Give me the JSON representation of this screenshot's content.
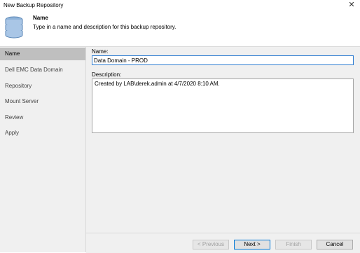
{
  "window": {
    "title": "New Backup Repository",
    "close_icon": "close-icon"
  },
  "header": {
    "icon": "database-icon",
    "title": "Name",
    "description": "Type in a name and description for this backup repository."
  },
  "sidebar": {
    "steps": [
      {
        "label": "Name",
        "active": true
      },
      {
        "label": "Dell EMC Data Domain",
        "active": false
      },
      {
        "label": "Repository",
        "active": false
      },
      {
        "label": "Mount Server",
        "active": false
      },
      {
        "label": "Review",
        "active": false
      },
      {
        "label": "Apply",
        "active": false
      }
    ]
  },
  "form": {
    "name_label": "Name:",
    "name_value": "Data Domain - PROD",
    "description_label": "Description:",
    "description_value": "Created by LAB\\derek.admin at 4/7/2020 8:10 AM."
  },
  "buttons": {
    "previous": "< Previous",
    "next": "Next >",
    "finish": "Finish",
    "cancel": "Cancel"
  }
}
